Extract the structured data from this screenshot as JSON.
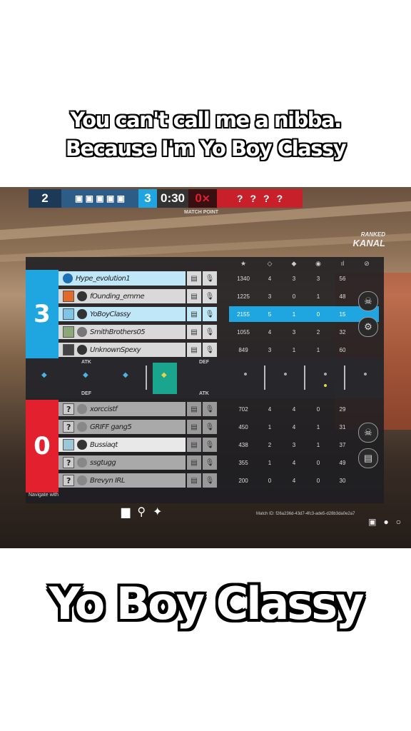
{
  "captions": {
    "top_line1": "You can't call me a nibba.",
    "top_line2": "Because I'm Yo Boy Classy",
    "bottom": "Yo Boy Classy"
  },
  "hud": {
    "blue_rounds": "2",
    "score_blue": "3",
    "timer": "0:30",
    "match_point": "MATCH POINT",
    "score_red": "0",
    "unknown_ops": [
      "?",
      "?",
      "?",
      "?"
    ]
  },
  "ranked": {
    "label": "RANKED",
    "map": "KANAL"
  },
  "columns": [
    "★",
    "◇",
    "◆",
    "◉",
    "ıl",
    "⊘"
  ],
  "blue_team": {
    "score": "3",
    "players": [
      {
        "name": "Hype_evolution1",
        "rank_badge": "2",
        "stats": [
          "1340",
          "4",
          "3",
          "3",
          "56"
        ]
      },
      {
        "name": "fOunding_emme",
        "rank_badge": "1",
        "stats": [
          "1225",
          "3",
          "0",
          "1",
          "48"
        ]
      },
      {
        "name": "YoBoyClassy",
        "rank_badge": "3",
        "stats": [
          "2155",
          "5",
          "1",
          "0",
          "15"
        ]
      },
      {
        "name": "SmithBrothers05",
        "rank_badge": "1",
        "stats": [
          "1055",
          "4",
          "3",
          "2",
          "32"
        ]
      },
      {
        "name": "UnknownSpexy",
        "rank_badge": "4",
        "stats": [
          "849",
          "3",
          "1",
          "1",
          "60"
        ]
      }
    ]
  },
  "round_labels": {
    "atk": "ATK",
    "def": "DEF"
  },
  "red_team": {
    "score": "0",
    "players": [
      {
        "name": "xorccistf",
        "stats": [
          "702",
          "4",
          "4",
          "0",
          "29"
        ]
      },
      {
        "name": "GRIFF gang5",
        "stats": [
          "450",
          "1",
          "4",
          "1",
          "31"
        ]
      },
      {
        "name": "Bussiaqt",
        "stats": [
          "438",
          "2",
          "3",
          "1",
          "37"
        ]
      },
      {
        "name": "ssgtugg",
        "stats": [
          "355",
          "1",
          "4",
          "0",
          "49"
        ]
      },
      {
        "name": "Brevyn IRL",
        "stats": [
          "200",
          "0",
          "4",
          "0",
          "30"
        ]
      }
    ]
  },
  "footer": {
    "navigate": "Navigate with",
    "match_id": "Match ID: f26a236d-43d7-4fc3-ade5-d28b3da0e2a7"
  },
  "colors": {
    "blue": "#1fa6e0",
    "red": "#e3202d",
    "highlight": "#bfe7f7"
  }
}
